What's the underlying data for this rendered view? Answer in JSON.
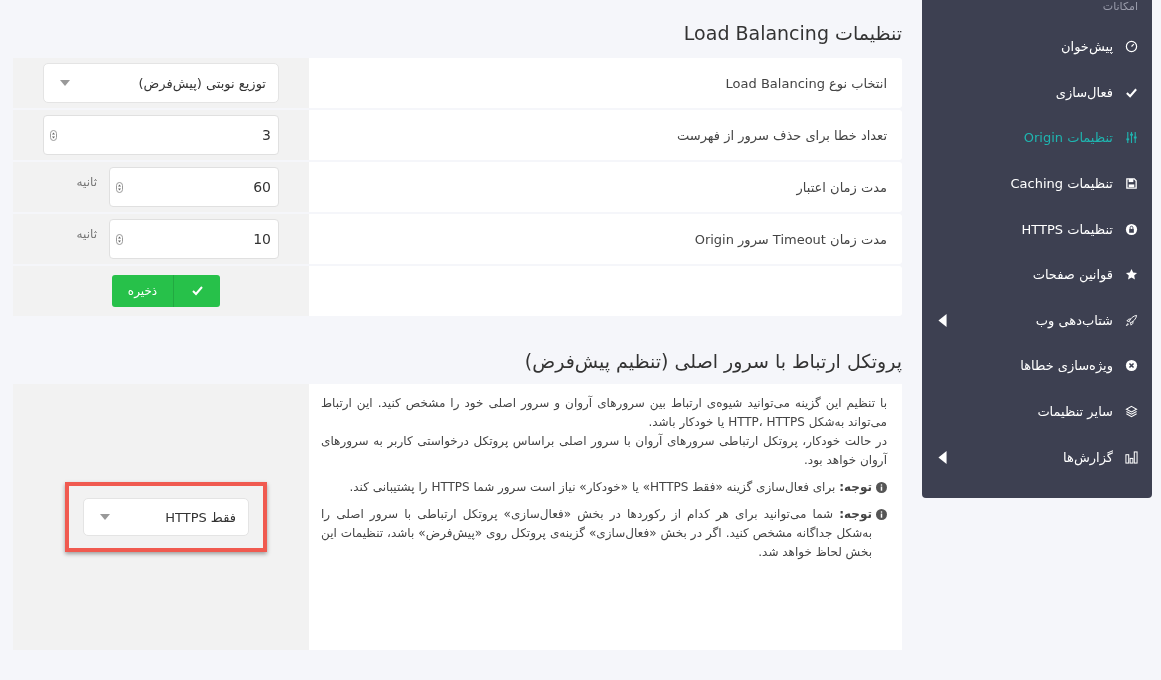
{
  "sidebar": {
    "heading": "امکانات",
    "items": [
      {
        "label": "پیش‌خوان",
        "selected": false,
        "submenu": false
      },
      {
        "label": "فعال‌سازی",
        "selected": false,
        "submenu": false
      },
      {
        "label": "تنظیمات Origin",
        "selected": true,
        "submenu": false
      },
      {
        "label": "تنظیمات Caching",
        "selected": false,
        "submenu": false
      },
      {
        "label": "تنظیمات HTTPS",
        "selected": false,
        "submenu": false
      },
      {
        "label": "قوانین صفحات",
        "selected": false,
        "submenu": false
      },
      {
        "label": "شتاب‌دهی وب",
        "selected": false,
        "submenu": true
      },
      {
        "label": "ویژه‌سازی خطاها",
        "selected": false,
        "submenu": false
      },
      {
        "label": "سایر تنظیمات",
        "selected": false,
        "submenu": false
      },
      {
        "label": "گزارش‌ها",
        "selected": false,
        "submenu": true
      }
    ]
  },
  "load_balancing": {
    "title": "تنظیمات Load Balancing",
    "rows": [
      {
        "kind": "select",
        "label": "انتخاب نوع Load Balancing",
        "value": "توزیع نوبتی (پیش‌فرض)"
      },
      {
        "kind": "number",
        "label": "تعداد خطا برای حذف سرور از فهرست",
        "value": "3"
      },
      {
        "kind": "number",
        "label": "مدت زمان اعتبار",
        "value": "60",
        "unit": "ثانیه"
      },
      {
        "kind": "number",
        "label": "مدت زمان Timeout سرور Origin",
        "value": "10",
        "unit": "ثانیه"
      }
    ],
    "save_button": "ذخیره"
  },
  "protocol": {
    "title": "پروتکل ارتباط با سرور اصلی (تنظیم پیش‌فرض)",
    "paragraphs": [
      "با تنظیم این گزینه می‌توانید شیوه‌ی ارتباط بین سرورهای آروان و سرور اصلی خود را مشخص کنید. این ارتباط می‌تواند به‌شکل HTTP، HTTPS یا خودکار باشد.",
      "در حالت خودکار، پروتکل ارتباطی سرورهای آروان با سرور اصلی براساس پروتکل درخواستی کاربر به سرورهای آروان خواهد بود."
    ],
    "notes": [
      "**توجه:** برای فعال‌سازی گزینه «فقط HTTPS» یا «خودکار» نیاز است سرور شما HTTPS را پشتیبانی کند.",
      "**توجه:** شما می‌توانید برای هر کدام از رکوردها در بخش «فعال‌سازی» پروتکل ارتباطی با سرور اصلی را به‌شکل جداگانه مشخص کنید. اگر در بخش «فعال‌سازی» گزینه‌ی پروتکل روی «پیش‌فرض» باشد، تنظیمات این بخش لحاظ خواهد شد."
    ],
    "select": {
      "value": "فقط HTTPS",
      "highlighted": true
    }
  }
}
